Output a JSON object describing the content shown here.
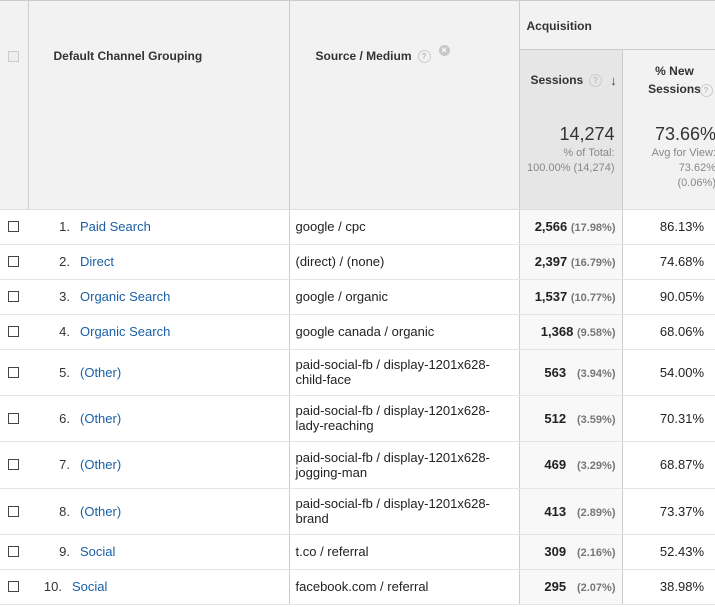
{
  "header": {
    "col_dimension": "Default Channel Grouping",
    "col_source": "Source / Medium",
    "group_acquisition": "Acquisition",
    "col_sessions": "Sessions",
    "col_new_sessions": "% New Sessions",
    "help_glyph": "?",
    "remove_glyph": "×",
    "sort_glyph": "↓"
  },
  "totals": {
    "sessions": "14,274",
    "sessions_sub1": "% of Total:",
    "sessions_sub2": "100.00% (14,274)",
    "new_sessions": "73.66%",
    "new_sub1": "Avg for View:",
    "new_sub2": "73.62%",
    "new_sub3": "(0.06%)"
  },
  "rows": [
    {
      "idx": "1.",
      "channel": "Paid Search",
      "src1": "google / cpc",
      "src2": "",
      "sessions": "2,566",
      "pct": "(17.98%)",
      "new": "86.13%"
    },
    {
      "idx": "2.",
      "channel": "Direct",
      "src1": "(direct) / (none)",
      "src2": "",
      "sessions": "2,397",
      "pct": "(16.79%)",
      "new": "74.68%"
    },
    {
      "idx": "3.",
      "channel": "Organic Search",
      "src1": "google / organic",
      "src2": "",
      "sessions": "1,537",
      "pct": "(10.77%)",
      "new": "90.05%"
    },
    {
      "idx": "4.",
      "channel": "Organic Search",
      "src1": "google canada / organic",
      "src2": "",
      "sessions": "1,368",
      "pct": "(9.58%)",
      "new": "68.06%"
    },
    {
      "idx": "5.",
      "channel": "(Other)",
      "src1": "paid-social-fb / display-1201x628-",
      "src2": "child-face",
      "sessions": "563",
      "pct": "(3.94%)",
      "new": "54.00%"
    },
    {
      "idx": "6.",
      "channel": "(Other)",
      "src1": "paid-social-fb / display-1201x628-",
      "src2": "lady-reaching",
      "sessions": "512",
      "pct": "(3.59%)",
      "new": "70.31%"
    },
    {
      "idx": "7.",
      "channel": "(Other)",
      "src1": "paid-social-fb / display-1201x628-",
      "src2": "jogging-man",
      "sessions": "469",
      "pct": "(3.29%)",
      "new": "68.87%"
    },
    {
      "idx": "8.",
      "channel": "(Other)",
      "src1": "paid-social-fb / display-1201x628-",
      "src2": "brand",
      "sessions": "413",
      "pct": "(2.89%)",
      "new": "73.37%"
    },
    {
      "idx": "9.",
      "channel": "Social",
      "src1": "t.co / referral",
      "src2": "",
      "sessions": "309",
      "pct": "(2.16%)",
      "new": "52.43%"
    },
    {
      "idx": "10.",
      "channel": "Social",
      "src1": "facebook.com / referral",
      "src2": "",
      "sessions": "295",
      "pct": "(2.07%)",
      "new": "38.98%"
    }
  ]
}
